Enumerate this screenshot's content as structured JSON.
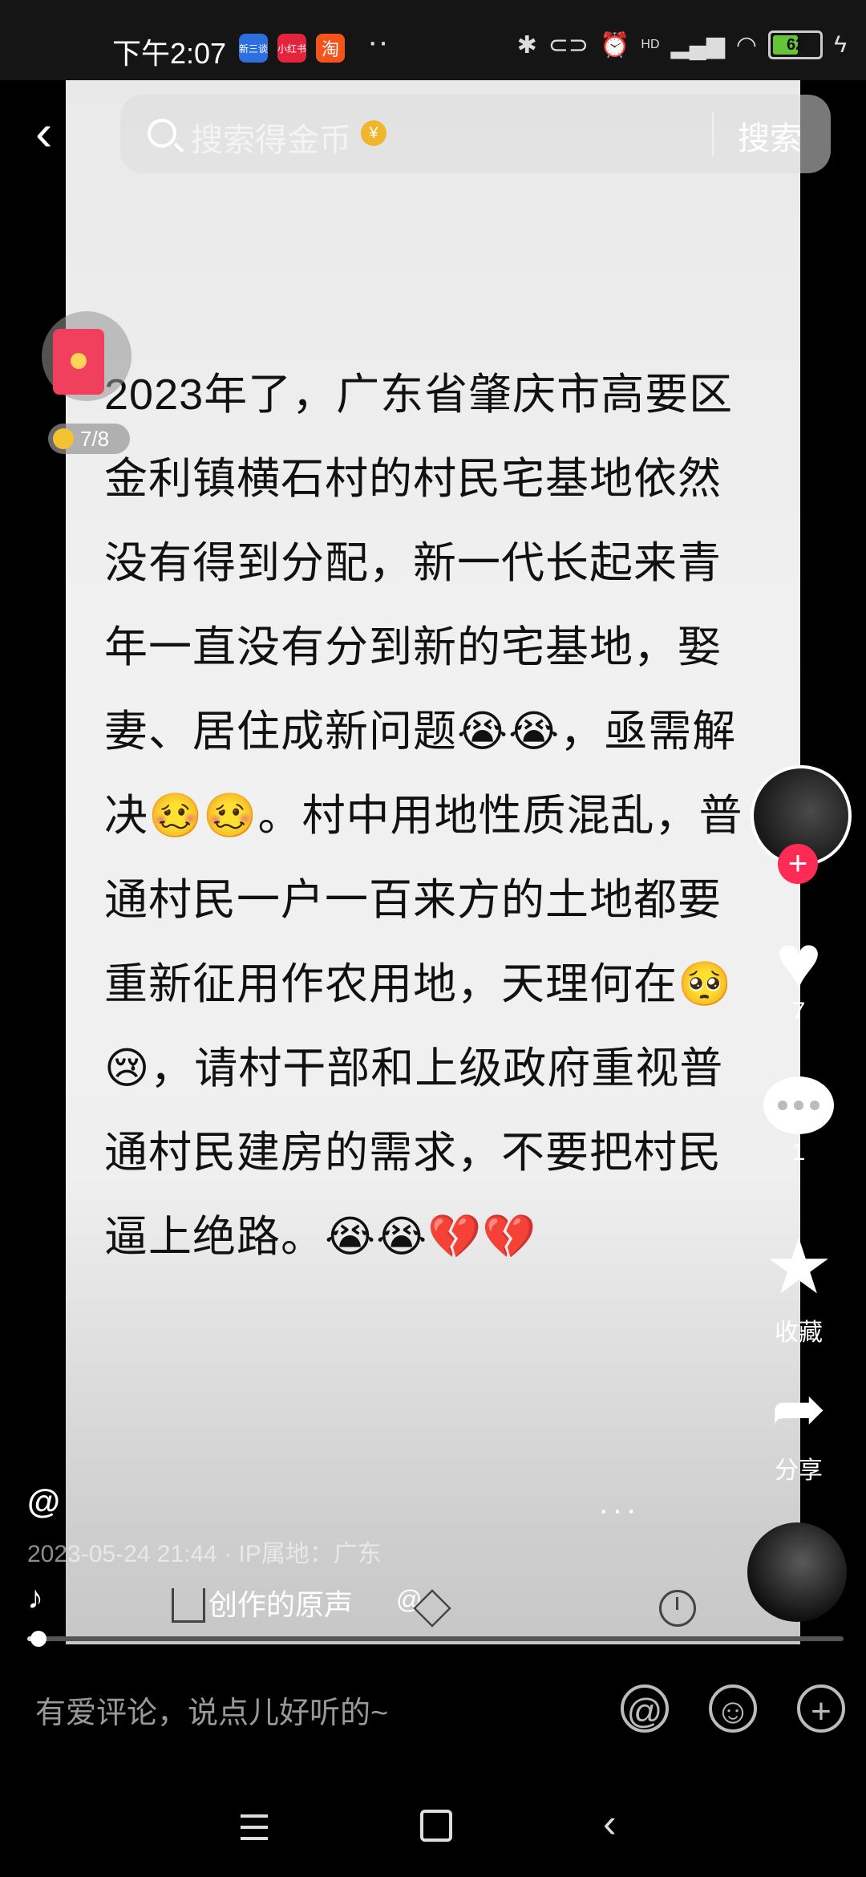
{
  "status_bar": {
    "time": "下午2:07",
    "apps": [
      {
        "name": "app-1",
        "label": "新三谈",
        "color": "#2e6fe0"
      },
      {
        "name": "app-2",
        "label": "小红书",
        "color": "#e4233d"
      },
      {
        "name": "app-3",
        "label": "淘",
        "color": "#f2541b"
      }
    ],
    "dots": "··",
    "battery_percent": "62",
    "battery_level": 0.62,
    "hd_label": "HD"
  },
  "search": {
    "placeholder": "搜索得金币",
    "coin_symbol": "¥",
    "button": "搜索"
  },
  "red_packet": {
    "progress": "7/8"
  },
  "post": {
    "text": "2023年了，广东省肇庆市高要区金利镇横石村的村民宅基地依然没有得到分配，新一代长起来青年一直没有分到新的宅基地，娶妻、居住成新问题😭😭，亟需解决🥴🥴。村中用地性质混乱，普通村民一户一百来方的土地都要重新征用作农用地，天理何在🥺😢，请村干部和上级政府重视普通村民建房的需求，不要把村民逼上绝路。😭😭💔💔",
    "author_at": "@",
    "more": "···",
    "meta": "2023-05-24 21:44 · IP属地：广东",
    "music_title": "创作的原声",
    "music_at": "@"
  },
  "rail": {
    "like_count": "7",
    "comment_count": "1",
    "favorite_label": "收藏",
    "share_label": "分享",
    "follow_symbol": "+"
  },
  "video_progress": 0.014,
  "comment_bar": {
    "placeholder": "有爱评论，说点儿好听的~",
    "mention_symbol": "@",
    "emoji_symbol": "☺",
    "add_symbol": "+"
  }
}
